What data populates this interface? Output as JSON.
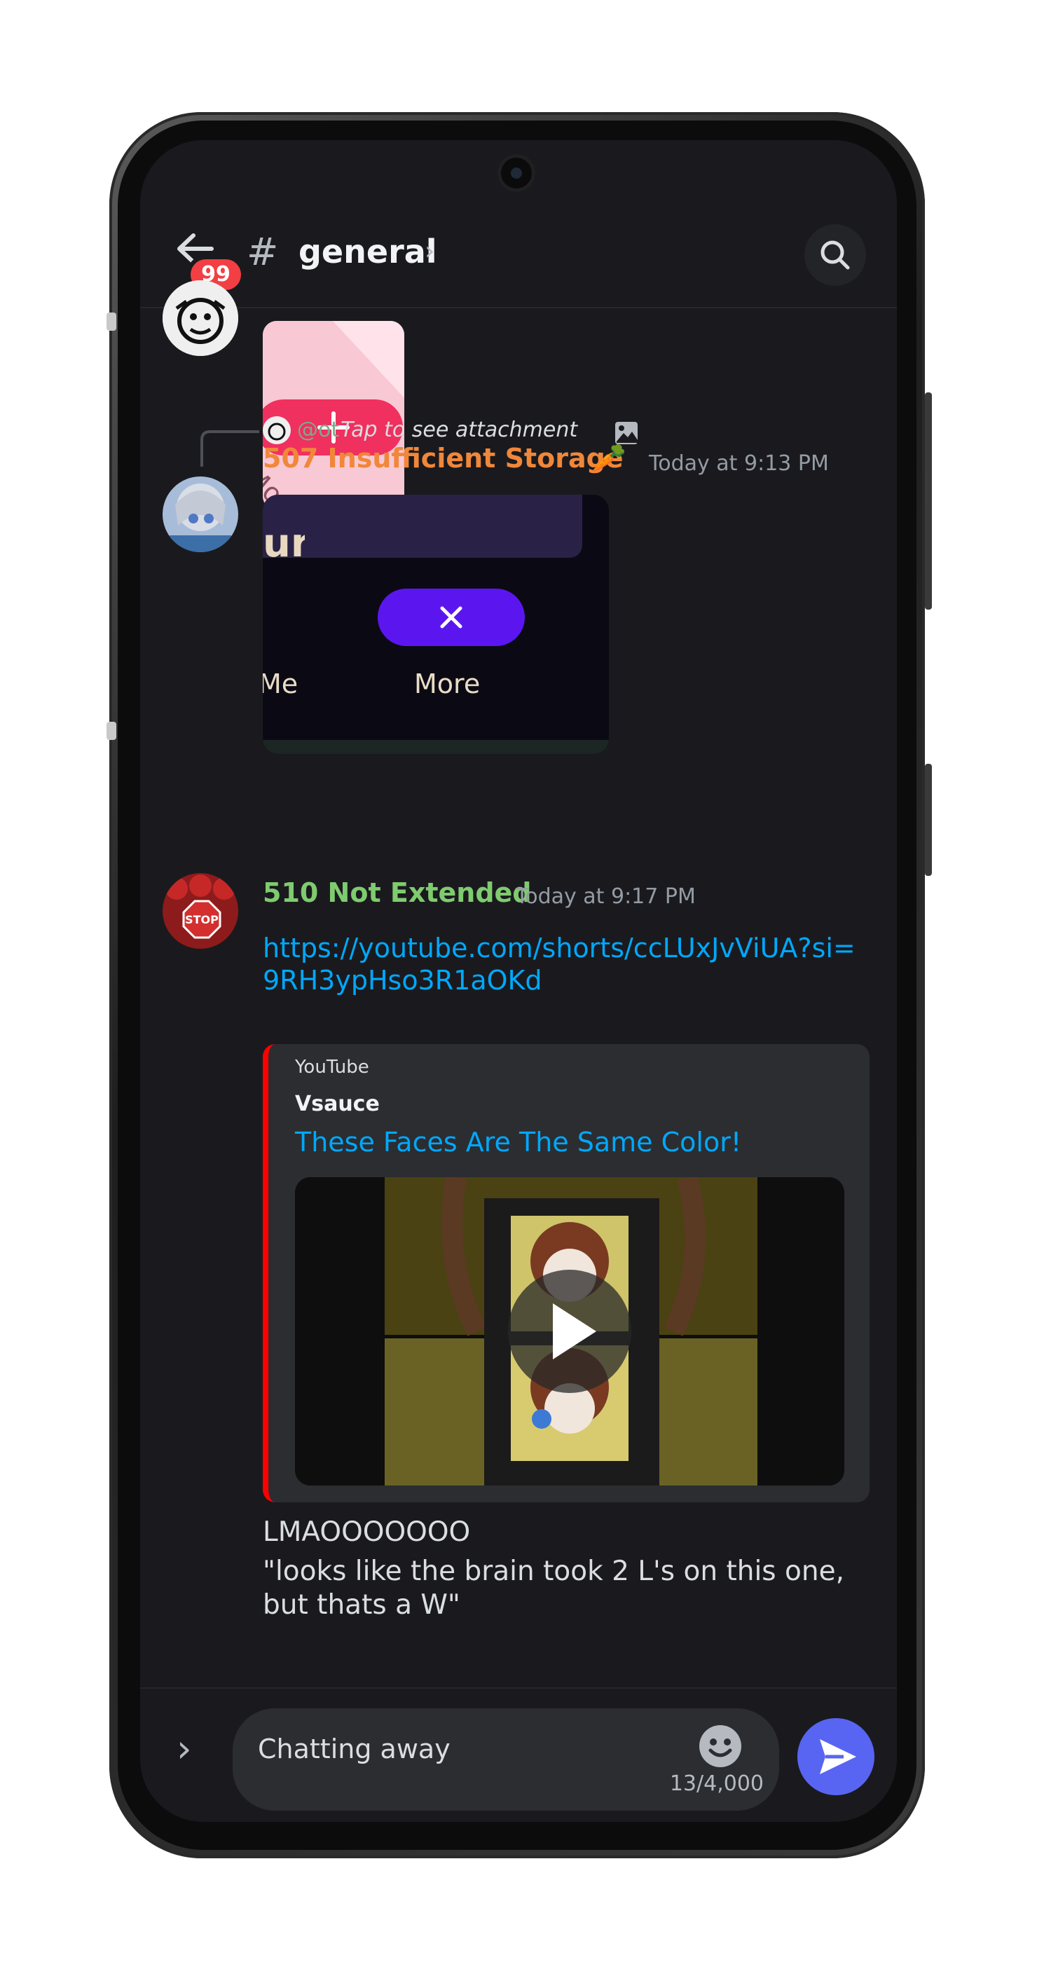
{
  "header": {
    "unread_badge": "99",
    "hash_symbol": "#",
    "channel_name": "general",
    "channel_chevron": "›"
  },
  "messages": [
    {
      "reply": {
        "mention": "@ot",
        "text": "Tap to see attachment"
      },
      "author": "507 Insufficient Storage",
      "author_emoji": "🥕",
      "author_color": "#f0873a",
      "timestamp": "Today at 9:13 PM",
      "attachment_labels": [
        "Me",
        "More"
      ]
    },
    {
      "author": "510 Not Extended",
      "author_color": "#7fcb6f",
      "timestamp": "Today at 9:17 PM",
      "link": "https://youtube.com/shorts/ccLUxJvViUA?si=9RH3ypHso3R1aOKd",
      "embed": {
        "provider": "YouTube",
        "author": "Vsauce",
        "title": "These Faces Are The Same Color!",
        "accent_color": "#ff0000"
      },
      "lines": [
        "LMAOOOOOOO",
        "\"looks like the brain took 2 L's on this one,",
        "but thats a W\""
      ]
    }
  ],
  "top_attachment_label": "More",
  "composer": {
    "value": "Chatting away",
    "char_count": "13/4,000",
    "expand_icon": "›"
  },
  "colors": {
    "background": "#1a1a1e",
    "link": "#00a8fc",
    "send_button": "#5865f2",
    "badge": "#f23f43"
  }
}
